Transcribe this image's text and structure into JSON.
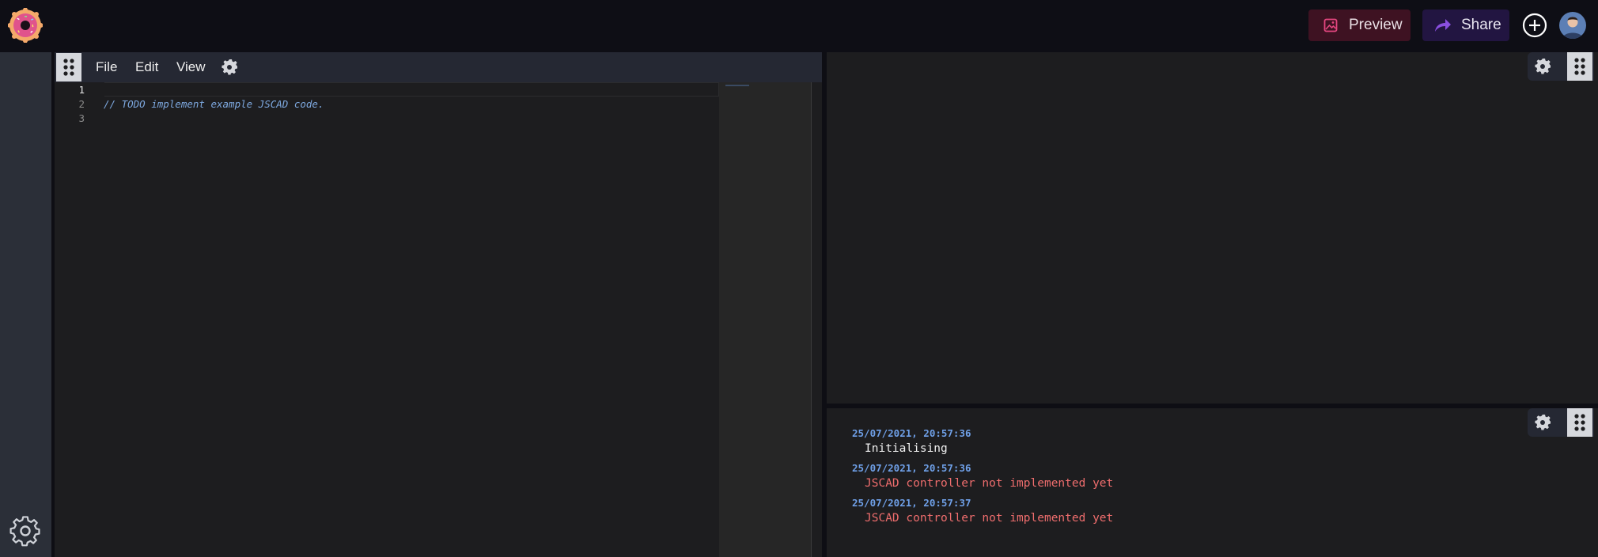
{
  "header": {
    "logo_icon": "donut-logo-icon",
    "preview_label": "Preview",
    "share_label": "Share",
    "plus_icon": "plus-circle-icon",
    "avatar_icon": "user-avatar"
  },
  "sidebar": {
    "settings_icon": "gear-icon"
  },
  "editor": {
    "menu": [
      "File",
      "Edit",
      "View"
    ],
    "lines": [
      "1",
      "2",
      "3"
    ],
    "code": "// TODO implement example JSCAD code.",
    "active_line": 1
  },
  "console": {
    "entries": [
      {
        "time": "25/07/2021, 20:57:36",
        "message": "Initialising",
        "level": "info"
      },
      {
        "time": "25/07/2021, 20:57:36",
        "message": "JSCAD controller not implemented yet",
        "level": "error"
      },
      {
        "time": "25/07/2021, 20:57:37",
        "message": "JSCAD controller not implemented yet",
        "level": "error"
      }
    ]
  },
  "colors": {
    "preview_bg": "#3e1222",
    "share_bg": "#221541",
    "accent_pink": "#e2467f",
    "accent_purple": "#8a4fe0",
    "timestamp": "#6fa0e8",
    "error": "#ee6d6d"
  }
}
